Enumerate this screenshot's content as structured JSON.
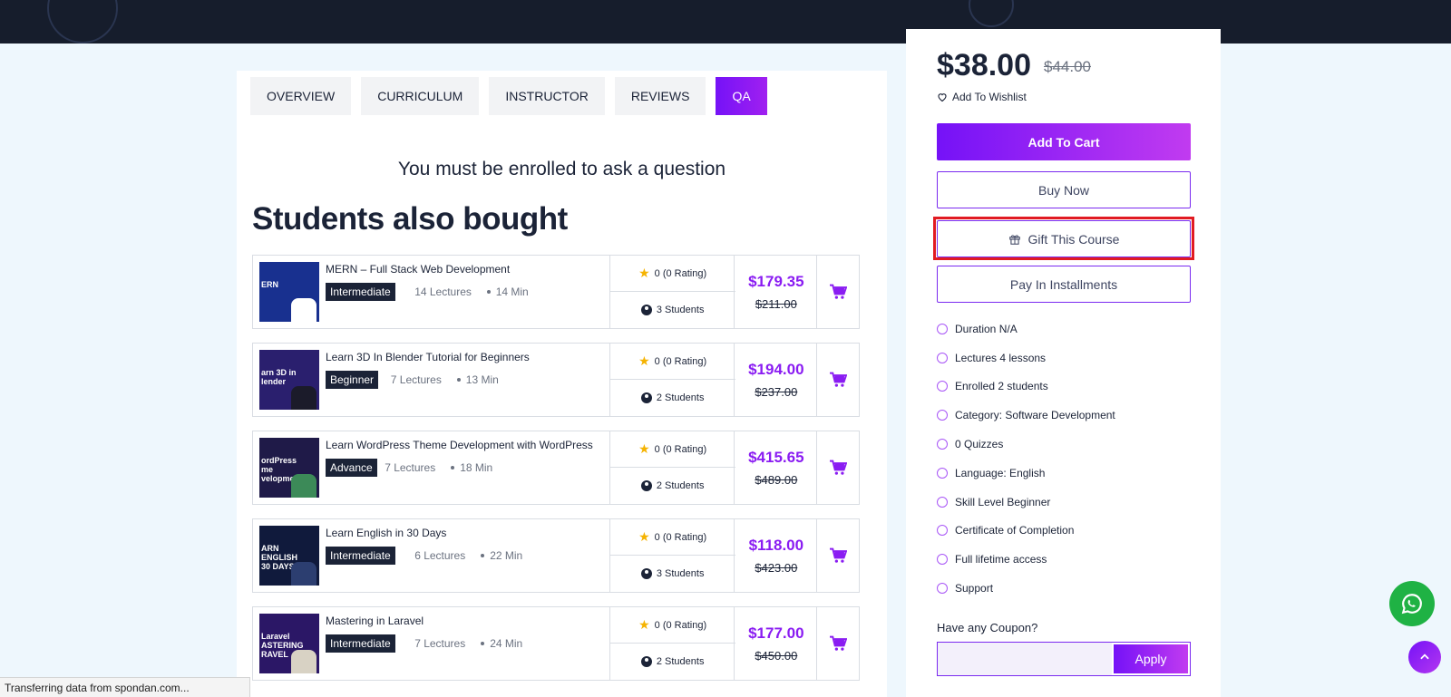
{
  "tabs": [
    {
      "label": "OVERVIEW",
      "active": false
    },
    {
      "label": "CURRICULUM",
      "active": false
    },
    {
      "label": "INSTRUCTOR",
      "active": false
    },
    {
      "label": "REVIEWS",
      "active": false
    },
    {
      "label": "QA",
      "active": true
    }
  ],
  "qa": {
    "message": "You must be enrolled to ask a question"
  },
  "related": {
    "title": "Students also bought",
    "courses": [
      {
        "title": "MERN – Full Stack Web Development",
        "level": "Intermediate",
        "lectures": "14 Lectures",
        "duration": "14 Min",
        "rating": "0 (0 Rating)",
        "students": "3 Students",
        "price": "$179.35",
        "old_price": "$211.00",
        "thumb_text": "ERN",
        "thumb_bg": "#18308f",
        "shirt": "#ffffff"
      },
      {
        "title": "Learn 3D In Blender Tutorial for Beginners",
        "level": "Beginner",
        "lectures": "7 Lectures",
        "duration": "13 Min",
        "rating": "0 (0 Rating)",
        "students": "2 Students",
        "price": "$194.00",
        "old_price": "$237.00",
        "thumb_text": "arn 3D in lender",
        "thumb_bg": "#2a1f6e",
        "shirt": "#1b1b2a"
      },
      {
        "title": "Learn WordPress Theme Development with WordPress",
        "level": "Advance",
        "lectures": "7 Lectures",
        "duration": "18 Min",
        "rating": "0 (0 Rating)",
        "students": "2 Students",
        "price": "$415.65",
        "old_price": "$489.00",
        "thumb_text": "ordPress me velopment",
        "thumb_bg": "#1f1a48",
        "shirt": "#3c8a58"
      },
      {
        "title": "Learn English in 30 Days",
        "level": "Intermediate",
        "lectures": "6 Lectures",
        "duration": "22 Min",
        "rating": "0 (0 Rating)",
        "students": "3 Students",
        "price": "$118.00",
        "old_price": "$423.00",
        "thumb_text": "ARN ENGLISH 30 DAYS",
        "thumb_bg": "#101a3c",
        "shirt": "#2c3e70"
      },
      {
        "title": "Mastering in Laravel",
        "level": "Intermediate",
        "lectures": "7 Lectures",
        "duration": "24 Min",
        "rating": "0 (0 Rating)",
        "students": "2 Students",
        "price": "$177.00",
        "old_price": "$450.00",
        "thumb_text": "Laravel ASTERING RAVEL",
        "thumb_bg": "#2b1766",
        "shirt": "#d8d2c4"
      }
    ]
  },
  "sidebar": {
    "price": "$38.00",
    "old_price": "$44.00",
    "wishlist": "Add To Wishlist",
    "add_to_cart": "Add To Cart",
    "buy_now": "Buy Now",
    "gift": "Gift This Course",
    "installments": "Pay In Installments",
    "features": [
      "Duration N/A",
      "Lectures 4 lessons",
      "Enrolled 2 students",
      "Category: Software Development",
      "0 Quizzes",
      "Language: English",
      "Skill Level Beginner",
      "Certificate of Completion",
      "Full lifetime access",
      "Support"
    ],
    "coupon_label": "Have any Coupon?",
    "coupon_value": "",
    "apply": "Apply"
  },
  "status": {
    "text": "Transferring data from spondan.com..."
  },
  "colors": {
    "accent": "#7512f7",
    "accent_end": "#c13bf0",
    "price_purple": "#8a1cf2",
    "highlight": "#e11b22",
    "whatsapp": "#1fb244",
    "dark": "#161d2c"
  },
  "icons": {
    "wishlist": "heart-icon",
    "cart": "cart-icon",
    "gift": "gift-icon",
    "rating": "star-icon",
    "students": "user-icon",
    "whatsapp": "whatsapp-icon",
    "scroll_top": "chevron-up-icon"
  }
}
